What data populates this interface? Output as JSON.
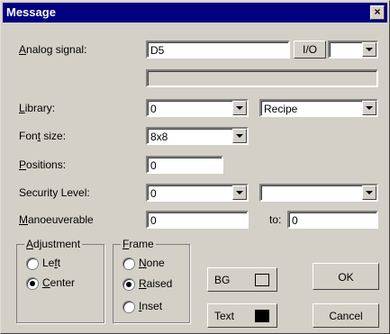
{
  "window": {
    "title": "Message",
    "close_label": "×"
  },
  "fields": {
    "analog_signal": {
      "label_u": "A",
      "label_rest": "nalog signal:",
      "value": "D5",
      "io_button": "I/O"
    },
    "library": {
      "label_u": "L",
      "label_rest": "ibrary:",
      "value": "0",
      "recipe_value": "Recipe"
    },
    "font_size": {
      "label_pre": "Fon",
      "label_u": "t",
      "label_rest": " size:",
      "value": "8x8"
    },
    "positions": {
      "label_u": "P",
      "label_rest": "ositions:",
      "value": "0"
    },
    "security": {
      "label": "Security Level:",
      "value": "0",
      "second_value": ""
    },
    "manoeuverable": {
      "label_u": "M",
      "label_rest": "anoeuverable",
      "value": "0",
      "to_label": "to:",
      "to_value": "0"
    }
  },
  "adjustment": {
    "title_u": "A",
    "title_rest": "djustment",
    "options": [
      {
        "pre": "Le",
        "u": "f",
        "rest": "t",
        "selected": false
      },
      {
        "pre": "",
        "u": "C",
        "rest": "enter",
        "selected": true
      }
    ]
  },
  "frame": {
    "title_u": "F",
    "title_rest": "rame",
    "options": [
      {
        "pre": "",
        "u": "N",
        "rest": "one",
        "selected": false
      },
      {
        "pre": "",
        "u": "R",
        "rest": "aised",
        "selected": true
      },
      {
        "pre": "",
        "u": "I",
        "rest": "nset",
        "selected": false
      }
    ]
  },
  "buttons": {
    "bg": "BG",
    "text": "Text",
    "ok": "OK",
    "cancel": "Cancel"
  },
  "colors": {
    "bg_swatch": "#d4d0c8",
    "text_swatch": "#000000",
    "titlebar": "#000080"
  }
}
